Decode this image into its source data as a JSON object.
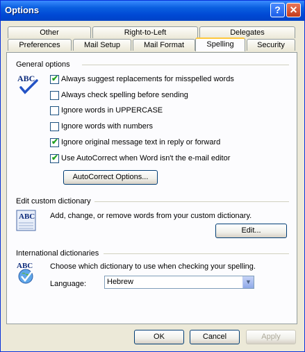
{
  "window": {
    "title": "Options"
  },
  "titlebar": {
    "help_glyph": "?",
    "close_glyph": "✕"
  },
  "tabs": {
    "row1": [
      "Other",
      "Right-to-Left",
      "Delegates"
    ],
    "row2": [
      "Preferences",
      "Mail Setup",
      "Mail Format",
      "Spelling",
      "Security"
    ],
    "active": "Spelling"
  },
  "general": {
    "label": "General options",
    "icon_text": "ABC",
    "options": [
      {
        "label": "Always suggest replacements for misspelled words",
        "checked": true
      },
      {
        "label": "Always check spelling before sending",
        "checked": false
      },
      {
        "label": "Ignore words in UPPERCASE",
        "checked": false
      },
      {
        "label": "Ignore words with numbers",
        "checked": false
      },
      {
        "label": "Ignore original message text in reply or forward",
        "checked": true
      },
      {
        "label": "Use AutoCorrect when Word isn't the e-mail editor",
        "checked": true
      }
    ],
    "autocorrect_button": "AutoCorrect Options..."
  },
  "custom_dictionary": {
    "label": "Edit custom dictionary",
    "icon_text": "ABC",
    "description": "Add, change, or remove words from your custom dictionary.",
    "edit_button": "Edit..."
  },
  "international": {
    "label": "International dictionaries",
    "icon_text": "ABC",
    "description": "Choose which dictionary to use when checking your spelling.",
    "language_label": "Language:",
    "language_value": "Hebrew"
  },
  "footer": {
    "ok": "OK",
    "cancel": "Cancel",
    "apply": "Apply"
  },
  "colors": {
    "titlebar": "#0049d5",
    "tab_highlight": "#ffc83c",
    "check": "#21a121"
  }
}
